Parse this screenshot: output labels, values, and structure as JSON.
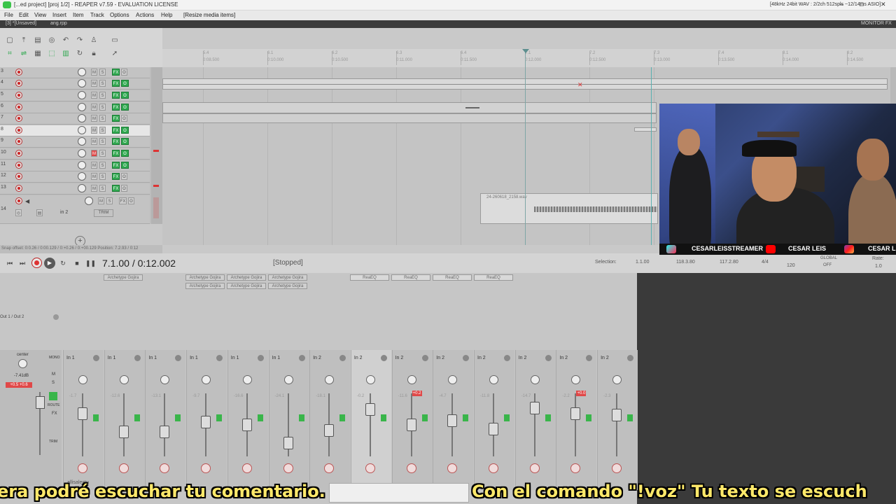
{
  "window": {
    "title": "[...ed project] [proj 1/2] - REAPER v7.59 - EVALUATION LICENSE",
    "audio_status": "[48kHz 24bit WAV : 2/2ch 512spls ~12/14ms ASIO]",
    "minimize": "–",
    "maximize": "□",
    "close": "✕"
  },
  "menu": {
    "items": [
      "File",
      "Edit",
      "View",
      "Insert",
      "Item",
      "Track",
      "Options",
      "Actions",
      "Help",
      "[Resize media items]"
    ]
  },
  "tabs": {
    "project": "[3] *[Unsaved]",
    "other": "ang.rpp",
    "monitor": "MONITOR FX"
  },
  "ruler": {
    "marks": [
      "5.4",
      "6.1",
      "6.2",
      "6.3",
      "6.4",
      "7.1",
      "7.2",
      "7.3",
      "7.4",
      "8.1",
      "8.2"
    ],
    "times": [
      "0:08.500",
      "0:10.000",
      "0:10.500",
      "0:11.000",
      "0:11.500",
      "0:12.000",
      "0:12.500",
      "0:13.000",
      "0:13.500",
      "0:14.000",
      "0:14.500"
    ]
  },
  "tracks": {
    "numbers": [
      "3",
      "4",
      "5",
      "6",
      "7",
      "8",
      "9",
      "10",
      "11",
      "12",
      "13"
    ],
    "last": {
      "number": "14",
      "input": "in 2",
      "trim": "TRIM"
    }
  },
  "arrange": {
    "item_label": "24-260618_2158.wav"
  },
  "status": {
    "snap": "Snap offset: 0:0.26 / 0:00.129 / 0:+0.26 / 0:+00.129 Position: 7.2.93 / 0:12"
  },
  "transport": {
    "position": "7.1.00 / 0:12.002",
    "state": "[Stopped]",
    "selection_label": "Selection:",
    "sel_start": "1.1.00",
    "sel_end": "118.3.80",
    "sel_length": "117.2.80",
    "time_sig": "4/4",
    "bpm": "120",
    "rate_label": "Rate:",
    "rate": "1.0",
    "global": "GLOBAL",
    "off": "OFF"
  },
  "mixer": {
    "master_label": "center",
    "master_db": "-7.41dB",
    "master_peak": "+0.5 +0.6",
    "master_buttons": [
      "MONO",
      "M",
      "S",
      "ROUTE",
      "FX",
      "TRIM"
    ],
    "out_label": "Out 1 / Out 2",
    "fx_slots": [
      {
        "label": "Archetype Gojira"
      },
      {
        "label": "Archetype Gojira"
      },
      {
        "label": "Archetype Gojira"
      },
      {
        "label": "Archetype Gojira"
      },
      {
        "label": "Archetype Gojira"
      },
      {
        "label": "Archetype Gojira"
      },
      {
        "label": "Archetype Gojira"
      },
      {
        "label": "ReaEQ"
      },
      {
        "label": "ReaEQ"
      },
      {
        "label": "ReaEQ"
      },
      {
        "label": "ReaEQ"
      }
    ],
    "strips": [
      {
        "input": "In 1",
        "vol": "-1.7"
      },
      {
        "input": "In 1",
        "vol": "-12.6"
      },
      {
        "input": "In 1",
        "vol": "-13.1"
      },
      {
        "input": "In 1",
        "vol": "-9.7"
      },
      {
        "input": "In 1",
        "vol": "-16.6"
      },
      {
        "input": "In 1",
        "vol": "-24.1"
      },
      {
        "input": "In 2",
        "vol": "-18.1"
      },
      {
        "input": "In 2",
        "vol": "-0.2"
      },
      {
        "input": "In 2",
        "vol": "-11.6",
        "peak": "+0.2"
      },
      {
        "input": "In 2",
        "vol": "-4.7"
      },
      {
        "input": "In 2",
        "vol": "-11.8"
      },
      {
        "input": "In 2",
        "vol": "-14.7"
      },
      {
        "input": "In 2",
        "vol": "-2.2",
        "peak": "+0.0"
      },
      {
        "input": "In 2",
        "vol": "-2.3"
      }
    ],
    "bottom_label": "allisalectu"
  },
  "stream": {
    "handles": [
      "CESARLEISSTREAMER",
      "CESAR LEIS",
      "CESAR LEI"
    ]
  },
  "subtitle": {
    "left": "era podré escuchar tu comentario.",
    "right": "Con el comando \"!voz\" Tu texto se escuch"
  },
  "colors": {
    "accent_green": "#2fa84f",
    "record_red": "#cc2222",
    "subtitle_yellow": "#ffe96a"
  }
}
